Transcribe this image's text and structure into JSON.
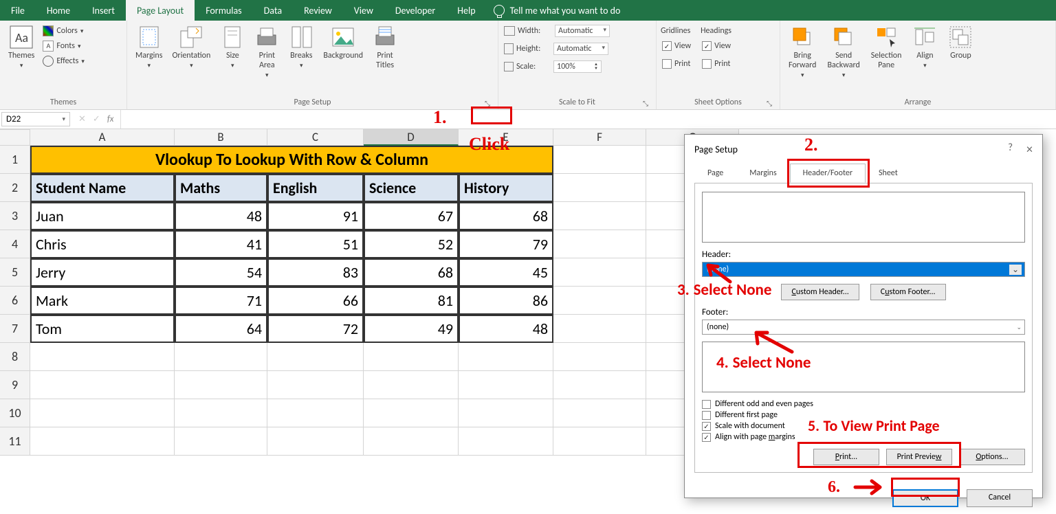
{
  "tabs": {
    "file": "File",
    "home": "Home",
    "insert": "Insert",
    "pageLayout": "Page Layout",
    "formulas": "Formulas",
    "data": "Data",
    "review": "Review",
    "view": "View",
    "developer": "Developer",
    "help": "Help",
    "tellMe": "Tell me what you want to do"
  },
  "ribbon": {
    "themes": {
      "title": "Themes",
      "themes": "Themes",
      "colors": "Colors",
      "fonts": "Fonts",
      "effects": "Effects"
    },
    "pageSetup": {
      "title": "Page Setup",
      "margins": "Margins",
      "orientation": "Orientation",
      "size": "Size",
      "printArea": "Print\nArea",
      "breaks": "Breaks",
      "background": "Background",
      "printTitles": "Print\nTitles"
    },
    "scaleToFit": {
      "title": "Scale to Fit",
      "width": "Width:",
      "height": "Height:",
      "scale": "Scale:",
      "auto": "Automatic",
      "scaleVal": "100%"
    },
    "sheetOptions": {
      "title": "Sheet Options",
      "gridlines": "Gridlines",
      "headings": "Headings",
      "view": "View",
      "print": "Print"
    },
    "arrange": {
      "title": "Arrange",
      "bringForward": "Bring\nForward",
      "sendBackward": "Send\nBackward",
      "selectionPane": "Selection\nPane",
      "align": "Align",
      "group": "Group"
    }
  },
  "nameBox": "D22",
  "columns": [
    "A",
    "B",
    "C",
    "D",
    "E",
    "F",
    "G"
  ],
  "rows": [
    "1",
    "2",
    "3",
    "4",
    "5",
    "6",
    "7",
    "8",
    "9",
    "10",
    "11"
  ],
  "titleRow": "Vlookup To Lookup With Row & Column",
  "headers": [
    "Student Name",
    "Maths",
    "English",
    "Science",
    "History"
  ],
  "dataRows": [
    {
      "name": "Juan",
      "vals": [
        48,
        91,
        67,
        68
      ]
    },
    {
      "name": "Chris",
      "vals": [
        41,
        51,
        52,
        79
      ]
    },
    {
      "name": "Jerry",
      "vals": [
        54,
        83,
        68,
        45
      ]
    },
    {
      "name": "Mark",
      "vals": [
        71,
        66,
        81,
        86
      ]
    },
    {
      "name": "Tom",
      "vals": [
        64,
        72,
        49,
        48
      ]
    }
  ],
  "dialog": {
    "title": "Page Setup",
    "tabs": {
      "page": "Page",
      "margins": "Margins",
      "headerFooter": "Header/Footer",
      "sheet": "Sheet"
    },
    "headerLabel": "Header:",
    "footerLabel": "Footer:",
    "none": "(none)",
    "customHeader": "Custom Header...",
    "customFooter": "Custom Footer...",
    "diffOddEven": "Different odd and even pages",
    "diffFirst": "Different first page",
    "scaleDoc": "Scale with document",
    "alignMargins": "Align with page margins",
    "print": "Print...",
    "printPreview": "Print Preview",
    "options": "Options...",
    "ok": "OK",
    "cancel": "Cancel",
    "help": "?",
    "close": "×"
  },
  "annotations": {
    "one": "1.",
    "click": "Click",
    "two": "2.",
    "three": "3.",
    "selectNone": "Select None",
    "four": "4.",
    "five": "5.",
    "toView": "To View Print Page",
    "six": "6."
  }
}
